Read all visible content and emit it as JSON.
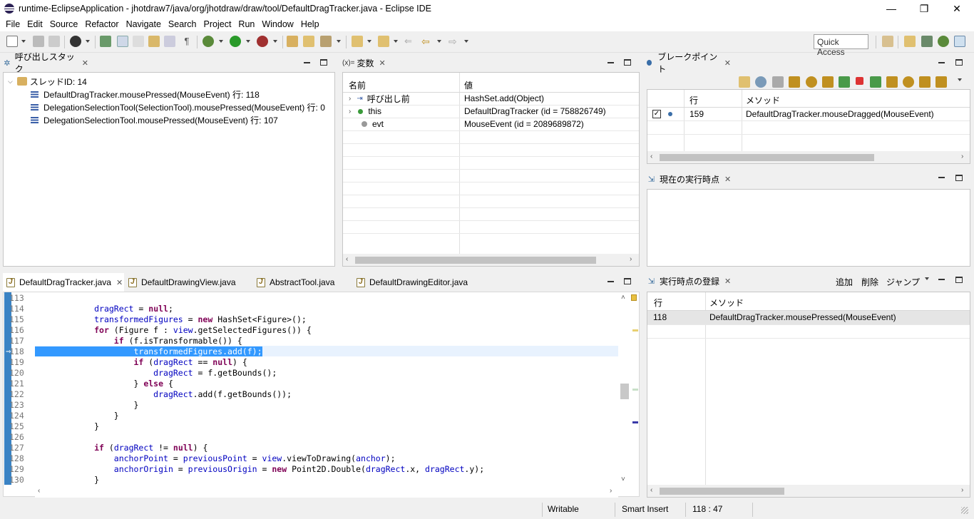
{
  "window": {
    "title": "runtime-EclipseApplication - jhotdraw7/java/org/jhotdraw/draw/tool/DefaultDragTracker.java - Eclipse IDE",
    "minimize": "—",
    "restore": "❐",
    "close": "✕"
  },
  "menu": [
    "File",
    "Edit",
    "Source",
    "Refactor",
    "Navigate",
    "Search",
    "Project",
    "Run",
    "Window",
    "Help"
  ],
  "quick_access": "Quick Access",
  "call_stack": {
    "tab": "呼び出しスタック",
    "thread": "スレッドID: 14",
    "frames": [
      "DefaultDragTracker.mousePressed(MouseEvent) 行: 118",
      "DelegationSelectionTool(SelectionTool).mousePressed(MouseEvent) 行: 0",
      "DelegationSelectionTool.mousePressed(MouseEvent) 行: 107"
    ]
  },
  "variables": {
    "tab": "変数",
    "tab_icon": "(x)=",
    "col_name": "名前",
    "col_value": "値",
    "rows": [
      {
        "name": "呼び出し前",
        "value": "HashSet.add(Object)",
        "icon": "return-icon"
      },
      {
        "name": "this",
        "value": "DefaultDragTracker  (id = 758826749)",
        "icon": "field-icon"
      },
      {
        "name": "evt",
        "value": "MouseEvent  (id = 2089689872)",
        "icon": "local-icon"
      }
    ]
  },
  "breakpoints": {
    "tab": "ブレークポイント",
    "col_line": "行",
    "col_method": "メソッド",
    "rows": [
      {
        "line": "159",
        "method": "DefaultDragTracker.mouseDragged(MouseEvent)",
        "checked": true
      }
    ]
  },
  "current_point": {
    "tab": "現在の実行時点"
  },
  "editor": {
    "tabs": [
      "DefaultDragTracker.java",
      "DefaultDrawingView.java",
      "AbstractTool.java",
      "DefaultDrawingEditor.java"
    ],
    "lines": [
      {
        "n": "113",
        "t": ""
      },
      {
        "n": "114",
        "t": "            dragRect = null;"
      },
      {
        "n": "115",
        "t": "            transformedFigures = new HashSet<Figure>();"
      },
      {
        "n": "116",
        "t": "            for (Figure f : view.getSelectedFigures()) {"
      },
      {
        "n": "117",
        "t": "                if (f.isTransformable()) {"
      },
      {
        "n": "118",
        "t": "                    transformedFigures.add(f);"
      },
      {
        "n": "119",
        "t": "                    if (dragRect == null) {"
      },
      {
        "n": "120",
        "t": "                        dragRect = f.getBounds();"
      },
      {
        "n": "121",
        "t": "                    } else {"
      },
      {
        "n": "122",
        "t": "                        dragRect.add(f.getBounds());"
      },
      {
        "n": "123",
        "t": "                    }"
      },
      {
        "n": "124",
        "t": "                }"
      },
      {
        "n": "125",
        "t": "            }"
      },
      {
        "n": "126",
        "t": ""
      },
      {
        "n": "127",
        "t": "            if (dragRect != null) {"
      },
      {
        "n": "128",
        "t": "                anchorPoint = previousPoint = view.viewToDrawing(anchor);"
      },
      {
        "n": "129",
        "t": "                anchorOrigin = previousOrigin = new Point2D.Double(dragRect.x, dragRect.y);"
      },
      {
        "n": "130",
        "t": "            }"
      }
    ]
  },
  "exec_points": {
    "tab": "実行時点の登録",
    "add": "追加",
    "delete": "削除",
    "jump": "ジャンプ",
    "col_line": "行",
    "col_method": "メソッド",
    "rows": [
      {
        "line": "118",
        "method": "DefaultDragTracker.mousePressed(MouseEvent)"
      }
    ]
  },
  "status": {
    "writable": "Writable",
    "insert": "Smart Insert",
    "position": "118 : 47"
  },
  "colors": {
    "selection": "#3399ff",
    "keyword": "#7f0055",
    "field": "#0000c0",
    "gutter": "#3a83c4"
  }
}
